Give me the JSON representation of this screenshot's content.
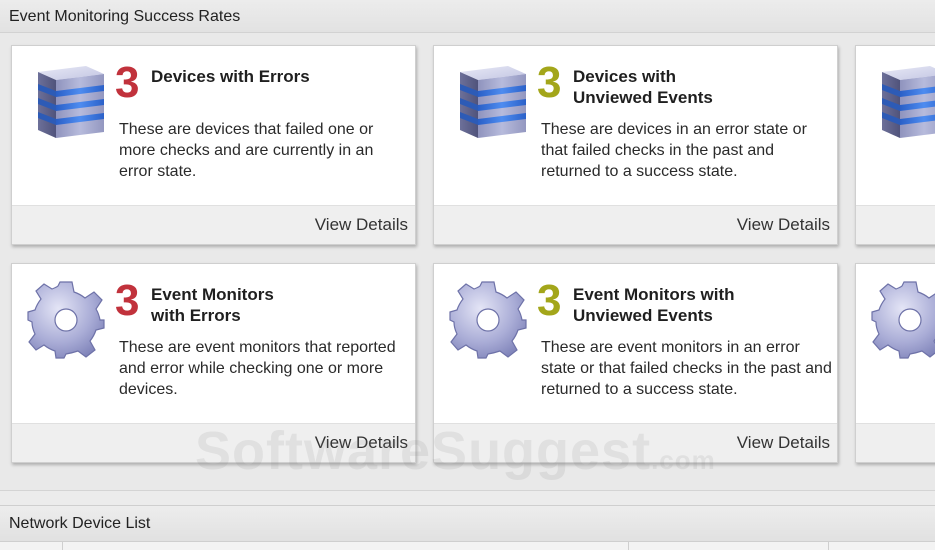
{
  "section1": {
    "title": "Event Monitoring Success Rates"
  },
  "cards": [
    {
      "count": "3",
      "count_color": "#c1323c",
      "title_line1": "Devices with Errors",
      "title_line2": "",
      "description": "These are devices that failed one or more checks and are currently in an error state.",
      "link": "View Details",
      "icon": "server-icon"
    },
    {
      "count": "3",
      "count_color": "#a3a61a",
      "title_line1": "Devices with",
      "title_line2": "Unviewed Events",
      "description": "These are devices in an error state or that failed checks in the past and returned to a success state.",
      "link": "View Details",
      "icon": "server-icon"
    },
    {
      "count": "3",
      "count_color": "#c1323c",
      "title_line1": "Event Monitors",
      "title_line2": "with Errors",
      "description": "These are event monitors that reported and error while checking one or more devices.",
      "link": "View Details",
      "icon": "gear-icon"
    },
    {
      "count": "3",
      "count_color": "#a3a61a",
      "title_line1": "Event Monitors with",
      "title_line2": "Unviewed Events",
      "description": "These are event monitors in an error state or that failed checks in the past and returned to a success state.",
      "link": "View Details",
      "icon": "gear-icon"
    }
  ],
  "section2": {
    "title": "Network Device List"
  },
  "watermark": {
    "text": "SoftwareSuggest",
    "suffix": ".com"
  }
}
